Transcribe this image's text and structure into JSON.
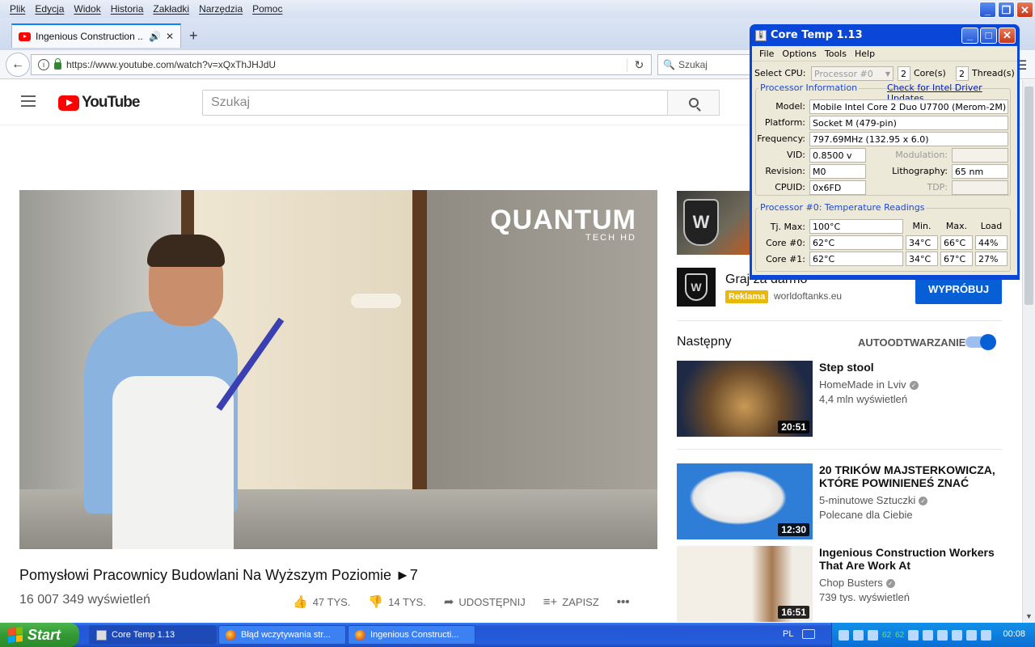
{
  "browser": {
    "menu": [
      "Plik",
      "Edycja",
      "Widok",
      "Historia",
      "Zakładki",
      "Narzędzia",
      "Pomoc"
    ],
    "tab_title": "Ingenious Construction ...",
    "url": "https://www.youtube.com/watch?v=xQxThJHJdU",
    "search_placeholder": "Szukaj"
  },
  "youtube": {
    "logo_text": "YouTube",
    "search_placeholder": "Szukaj",
    "video": {
      "overlay_brand": "QUANTUM",
      "overlay_sub": "TECH HD",
      "title": "Pomysłowi Pracownicy Budowlani Na Wyższym Poziomie ►7",
      "views": "16 007 349 wyświetleń",
      "likes": "47 TYS.",
      "dislikes": "14 TYS.",
      "share": "UDOSTĘPNIJ",
      "save": "ZAPISZ"
    },
    "ad": {
      "title": "Graj za darmo",
      "badge": "Reklama",
      "domain": "worldoftanks.eu",
      "button": "WYPRÓBUJ"
    },
    "next_label": "Następny",
    "autoplay_label": "AUTOODTWARZANIE",
    "recommendations": [
      {
        "title": "Step stool",
        "channel": "HomeMade in Lviv",
        "meta": "4,4 mln wyświetleń",
        "duration": "20:51"
      },
      {
        "title": "20 TRIKÓW MAJSTERKOWICZA, KTÓRE POWINIENEŚ ZNAĆ",
        "channel": "5-minutowe Sztuczki",
        "meta": "Polecane dla Ciebie",
        "duration": "12:30"
      },
      {
        "title": "Ingenious Construction Workers That Are Work At",
        "channel": "Chop Busters",
        "meta": "739 tys. wyświetleń",
        "duration": "16:51"
      }
    ]
  },
  "coretemp": {
    "title": "Core Temp 1.13",
    "menu": [
      "File",
      "Options",
      "Tools",
      "Help"
    ],
    "select_cpu_label": "Select CPU:",
    "processor_select": "Processor #0",
    "cores_count": "2",
    "cores_label": "Core(s)",
    "threads_count": "2",
    "threads_label": "Thread(s)",
    "info_group": "Processor Information",
    "driver_link": "Check for Intel Driver Updates",
    "model_label": "Model:",
    "model": "Mobile Intel Core 2 Duo U7700 (Merom-2M)",
    "platform_label": "Platform:",
    "platform": "Socket M (479-pin)",
    "frequency_label": "Frequency:",
    "frequency": "797.69MHz (132.95 x 6.0)",
    "vid_label": "VID:",
    "vid": "0.8500 v",
    "modulation_label": "Modulation:",
    "revision_label": "Revision:",
    "revision": "M0",
    "lithography_label": "Lithography:",
    "lithography": "65 nm",
    "cpuid_label": "CPUID:",
    "cpuid": "0x6FD",
    "tdp_label": "TDP:",
    "temp_group": "Processor #0: Temperature Readings",
    "col_min": "Min.",
    "col_max": "Max.",
    "col_load": "Load",
    "tjmax_label": "Tj. Max:",
    "tjmax": "100°C",
    "cores": [
      {
        "label": "Core #0:",
        "temp": "62°C",
        "min": "34°C",
        "max": "66°C",
        "load": "44%"
      },
      {
        "label": "Core #1:",
        "temp": "62°C",
        "min": "34°C",
        "max": "67°C",
        "load": "27%"
      }
    ]
  },
  "taskbar": {
    "start": "Start",
    "tasks": [
      "Core Temp 1.13",
      "Błąd wczytywania str...",
      "Ingenious Constructi..."
    ],
    "lang": "PL",
    "tray_temps": [
      "62",
      "62"
    ],
    "clock": "00:08"
  },
  "colors": {
    "youtube_red": "#ff0000",
    "youtube_blue": "#065fd4",
    "xp_blue": "#245ddb",
    "xp_green": "#339a33",
    "reklama_yellow": "#e8b90b"
  }
}
